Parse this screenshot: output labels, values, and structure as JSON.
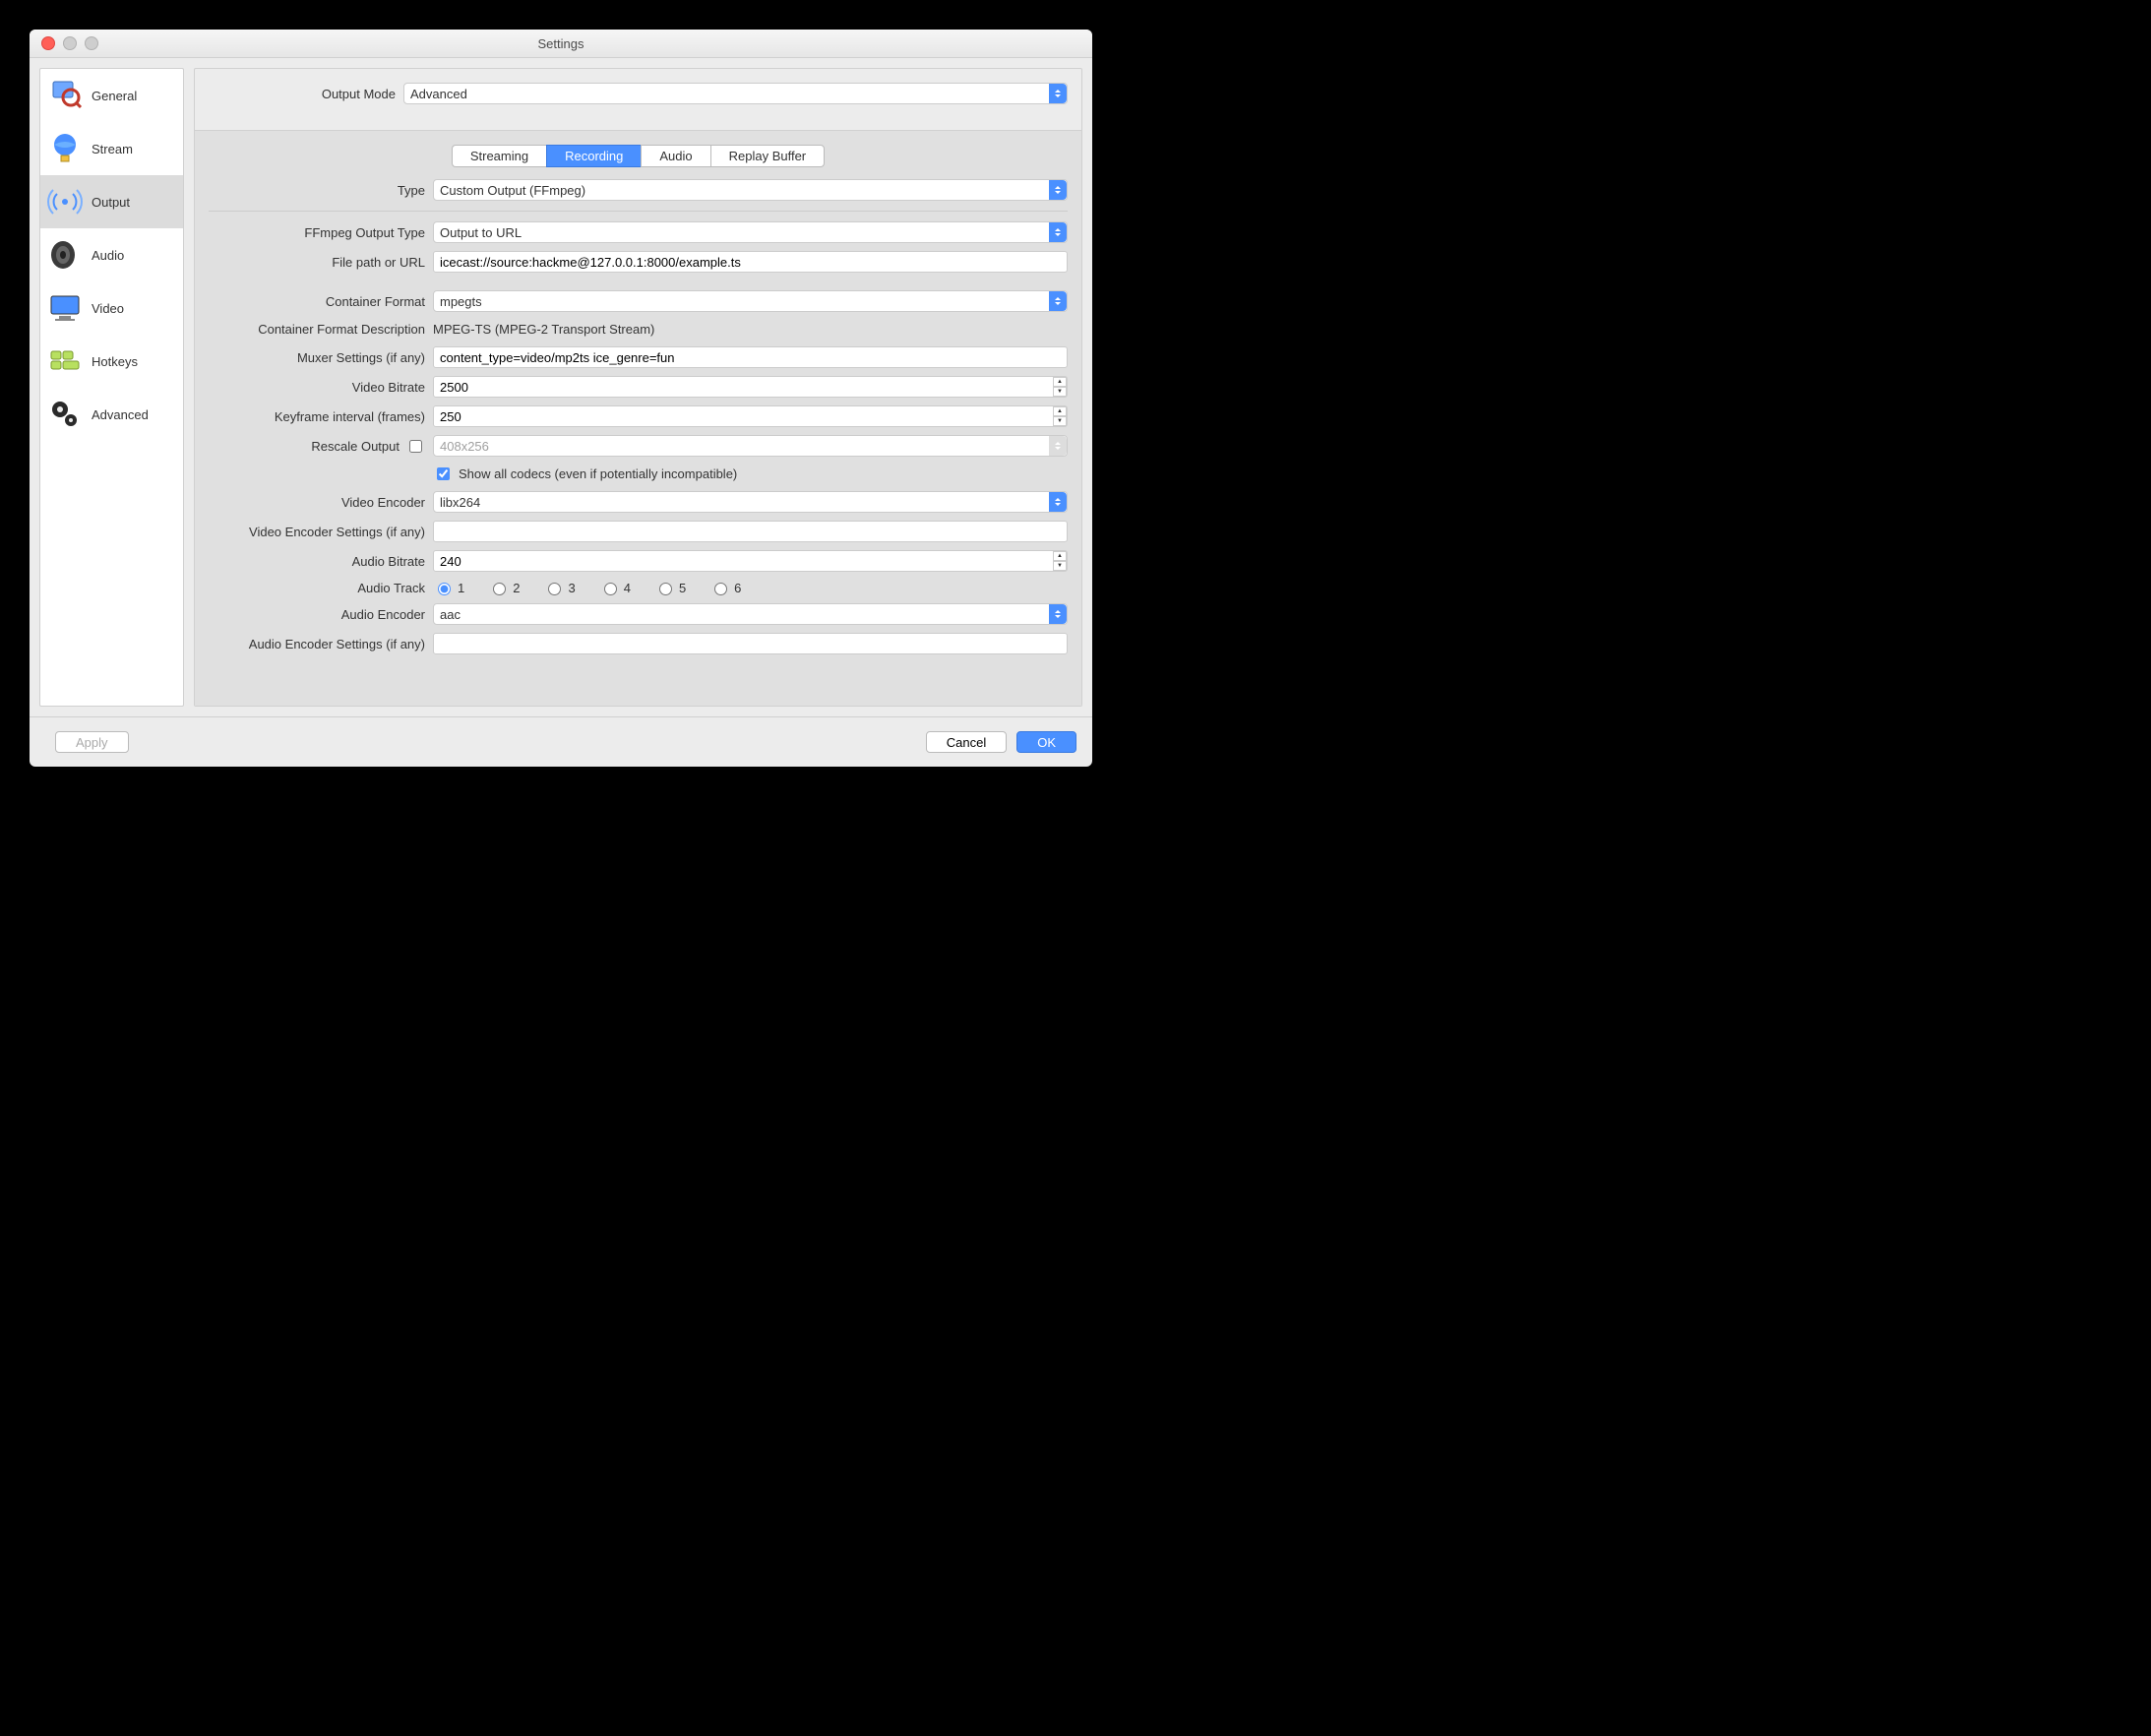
{
  "window": {
    "title": "Settings"
  },
  "sidebar": {
    "items": [
      {
        "label": "General"
      },
      {
        "label": "Stream"
      },
      {
        "label": "Output"
      },
      {
        "label": "Audio"
      },
      {
        "label": "Video"
      },
      {
        "label": "Hotkeys"
      },
      {
        "label": "Advanced"
      }
    ]
  },
  "output": {
    "mode_label": "Output Mode",
    "mode_value": "Advanced",
    "tabs": [
      "Streaming",
      "Recording",
      "Audio",
      "Replay Buffer"
    ],
    "recording": {
      "type_label": "Type",
      "type_value": "Custom Output (FFmpeg)",
      "ffmpeg_output_type_label": "FFmpeg Output Type",
      "ffmpeg_output_type_value": "Output to URL",
      "file_path_label": "File path or URL",
      "file_path_value": "icecast://source:hackme@127.0.0.1:8000/example.ts",
      "container_format_label": "Container Format",
      "container_format_value": "mpegts",
      "container_desc_label": "Container Format Description",
      "container_desc_value": "MPEG-TS (MPEG-2 Transport Stream)",
      "muxer_settings_label": "Muxer Settings (if any)",
      "muxer_settings_value": "content_type=video/mp2ts ice_genre=fun",
      "video_bitrate_label": "Video Bitrate",
      "video_bitrate_value": "2500",
      "keyframe_label": "Keyframe interval (frames)",
      "keyframe_value": "250",
      "rescale_label": "Rescale Output",
      "rescale_placeholder": "408x256",
      "show_all_codecs_label": "Show all codecs (even if potentially incompatible)",
      "video_encoder_label": "Video Encoder",
      "video_encoder_value": "libx264",
      "video_encoder_settings_label": "Video Encoder Settings (if any)",
      "video_encoder_settings_value": "",
      "audio_bitrate_label": "Audio Bitrate",
      "audio_bitrate_value": "240",
      "audio_track_label": "Audio Track",
      "audio_track_options": [
        "1",
        "2",
        "3",
        "4",
        "5",
        "6"
      ],
      "audio_track_selected": "1",
      "audio_encoder_label": "Audio Encoder",
      "audio_encoder_value": "aac",
      "audio_encoder_settings_label": "Audio Encoder Settings (if any)",
      "audio_encoder_settings_value": ""
    }
  },
  "footer": {
    "apply_label": "Apply",
    "cancel_label": "Cancel",
    "ok_label": "OK"
  }
}
